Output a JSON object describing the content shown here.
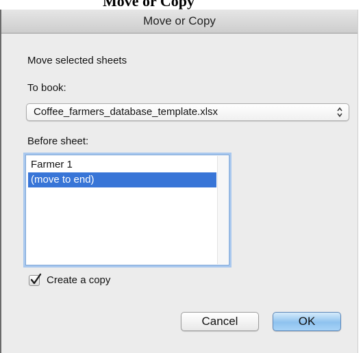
{
  "background": {
    "heading_partial": "Move or Copy"
  },
  "dialog": {
    "title": "Move or Copy",
    "move_label": "Move selected sheets",
    "to_book_label": "To book:",
    "to_book_value": "Coffee_farmers_database_template.xlsx",
    "before_sheet_label": "Before sheet:",
    "sheets": [
      {
        "label": "Farmer 1",
        "selected": false
      },
      {
        "label": "(move to end)",
        "selected": true
      }
    ],
    "create_copy": {
      "label": "Create a copy",
      "checked": true
    },
    "cancel_label": "Cancel",
    "ok_label": "OK"
  },
  "colors": {
    "selection": "#3875d7",
    "focus_ring": "#a9c8ee",
    "default_button": "#8ec2ef",
    "dialog_bg": "#ececec"
  },
  "icons": {
    "select_arrows": "updown-chevron-icon",
    "checkbox_mark": "checkmark-icon"
  }
}
